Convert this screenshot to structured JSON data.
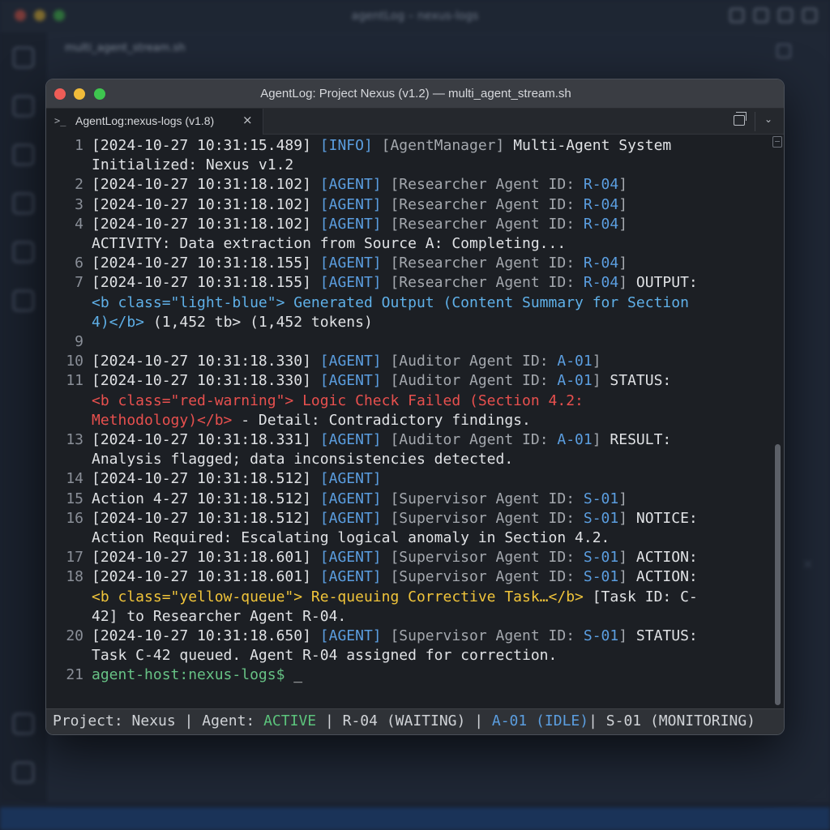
{
  "background": {
    "window_title": "agentLog – nexus-logs",
    "tab_label": "multi_agent_stream.sh",
    "colors": {
      "bg": "#1b2230",
      "statusbar": "#1a3358"
    }
  },
  "window": {
    "title": "AgentLog: Project Nexus (v1.2) — multi_agent_stream.sh",
    "traffic_lights": [
      "close",
      "minimize",
      "zoom"
    ],
    "colors": {
      "close": "#ee5d57",
      "minimize": "#f1bc3a",
      "zoom": "#3ec64f"
    }
  },
  "tab": {
    "prompt_icon": ">_",
    "label": "AgentLog:nexus-logs (v1.8)",
    "close_icon": "×",
    "split_icon": "split-pane-icon",
    "chevron_icon": "chevron-down-icon"
  },
  "lines": [
    {
      "n": "1",
      "ts": "[2024-10-27 10:31:15.489] ",
      "tag": "[INFO]",
      "agent": " [AgentManager]",
      "id": "",
      "tail": " Multi-Agent System"
    },
    {
      "n": "",
      "plain": "Initialized: Nexus v1.2"
    },
    {
      "n": "2",
      "ts": "[2024-10-27 10:31:18.102] ",
      "tag": "[AGENT]",
      "agent": " [Researcher Agent ID: ",
      "id": "R-04",
      "close": "]",
      "tail": ""
    },
    {
      "n": "3",
      "ts": "[2024-10-27 10:31:18.102] ",
      "tag": "[AGENT]",
      "agent": " [Researcher Agent ID: ",
      "id": "R-04",
      "close": "]",
      "tail": ""
    },
    {
      "n": "4",
      "ts": "[2024-10-27 10:31:18.102] ",
      "tag": "[AGENT]",
      "agent": " [Researcher Agent ID: ",
      "id": "R-04",
      "close": "]",
      "tail": ""
    },
    {
      "n": "",
      "plain": "ACTIVITY: Data extraction from Source A: Completing..."
    },
    {
      "n": "6",
      "ts": "[2024-10-27 10:31:18.155] ",
      "tag": "[AGENT]",
      "agent": " [Researcher Agent ID: ",
      "id": "R-04",
      "close": "]",
      "tail": ""
    },
    {
      "n": "7",
      "ts": "[2024-10-27 10:31:18.155] ",
      "tag": "[AGENT]",
      "agent": " [Researcher Agent ID: ",
      "id": "R-04",
      "close": "]",
      "tail": " OUTPUT:"
    },
    {
      "n": "",
      "blue": "<b class=\"light-blue\"> Generated Output (Content Summary for Section"
    },
    {
      "n": "",
      "blue": "4)</b>",
      "after": " (1,452 tb> (1,452 tokens)"
    },
    {
      "n": "9",
      "plain": ""
    },
    {
      "n": "10",
      "ts": "[2024-10-27 10:31:18.330] ",
      "tag": "[AGENT]",
      "agent": " [Auditor Agent ID: ",
      "id": "A-01",
      "close": "]",
      "tail": ""
    },
    {
      "n": "11",
      "ts": "[2024-10-27 10:31:18.330] ",
      "tag": "[AGENT]",
      "agent": " [Auditor Agent ID: ",
      "id": "A-01",
      "close": "]",
      "tail": " STATUS:"
    },
    {
      "n": "",
      "red": "<b class=\"red-warning\"> Logic Check Failed (Section 4.2:"
    },
    {
      "n": "",
      "red": "Methodology)</b>",
      "after": " - Detail: Contradictory findings."
    },
    {
      "n": "13",
      "ts": "[2024-10-27 10:31:18.331] ",
      "tag": "[AGENT]",
      "agent": " [Auditor Agent ID: ",
      "id": "A-01",
      "close": "]",
      "tail": " RESULT:"
    },
    {
      "n": "",
      "plain": "Analysis flagged; data inconsistencies detected."
    },
    {
      "n": "14",
      "ts": "[2024-10-27 10:31:18.512] ",
      "tag": "[AGENT]",
      "agent": "",
      "id": "",
      "tail": ""
    },
    {
      "n": "15",
      "ts": "Action 4-27 10:31:18.512] ",
      "tag": "[AGENT]",
      "agent": " [Supervisor Agent ID: ",
      "id": "S-01",
      "close": "]",
      "tail": ""
    },
    {
      "n": "16",
      "ts": "[2024-10-27 10:31:18.512] ",
      "tag": "[AGENT]",
      "agent": " [Supervisor Agent ID: ",
      "id": "S-01",
      "close": "]",
      "tail": " NOTICE:"
    },
    {
      "n": "",
      "plain": "Action Required: Escalating logical anomaly in Section 4.2."
    },
    {
      "n": "17",
      "ts": "[2024-10-27 10:31:18.601] ",
      "tag": "[AGENT]",
      "agent": " [Supervisor Agent ID: ",
      "id": "S-01",
      "close": "]",
      "tail": " ACTION:"
    },
    {
      "n": "18",
      "ts": "[2024-10-27 10:31:18.601] ",
      "tag": "[AGENT]",
      "agent": " [Supervisor Agent ID: ",
      "id": "S-01",
      "close": "]",
      "tail": " ACTION:"
    },
    {
      "n": "",
      "yellow": "<b class=\"yellow-queue\"> Re-queuing Corrective Task…</b>",
      "after": " [Task ID: C-"
    },
    {
      "n": "",
      "plain": "42] to Researcher Agent R-04."
    },
    {
      "n": "20",
      "ts": "[2024-10-27 10:31:18.650] ",
      "tag": "[AGENT]",
      "agent": " [Supervisor Agent ID: ",
      "id": "S-01",
      "close": "]",
      "tail": " STATUS:"
    },
    {
      "n": "",
      "plain": "Task C-42 queued. Agent R-04 assigned for correction."
    },
    {
      "n": "21",
      "prompt": "agent-host:nexus-logs$",
      "cursor": " _"
    }
  ],
  "statusbar": {
    "project": "Project: Nexus | Agent: ",
    "agent_state": "ACTIVE",
    "r04": " | R-04 (WAITING) | ",
    "a01": "A-01 (IDLE)",
    "s01": "| S-01 (MONITORING)"
  }
}
